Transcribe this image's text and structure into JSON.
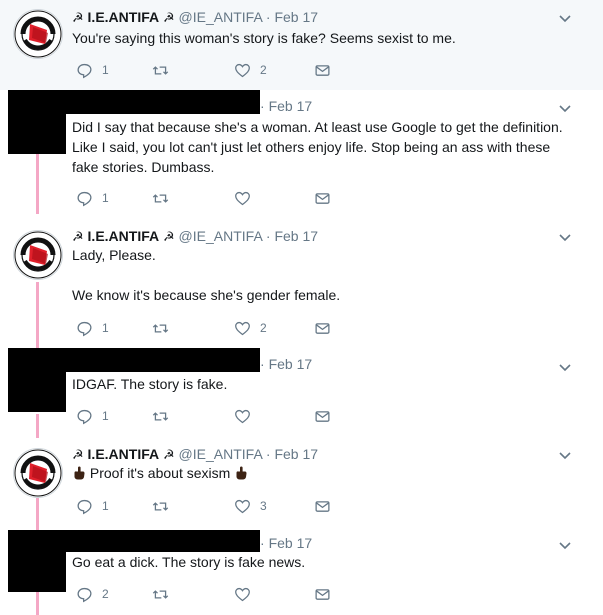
{
  "icons": {
    "reply": "reply-icon",
    "retweet": "retweet-icon",
    "like": "heart-icon",
    "dm": "envelope-icon",
    "more": "chevron-down-icon",
    "emoji": "middle-finger-emoji"
  },
  "colors": {
    "thread_line": "#f4a7c5",
    "muted": "#657786",
    "text": "#14171a",
    "highlight_bg": "#f5f8fa",
    "antifa_red": "#e0202b"
  },
  "avatar_text": "ANTIFASCHISTISCHE AKTION",
  "tweets": [
    {
      "author": "I.E.ANTIFA",
      "handle": "@IE_ANTIFA",
      "sep": "·",
      "date": "Feb 17",
      "lines": [
        "You're saying this woman's story is fake? Seems sexist to me."
      ],
      "replies": "1",
      "retweets": "",
      "likes": "2"
    },
    {
      "author": "",
      "handle": "",
      "sep": "·",
      "date": "Feb 17",
      "lines": [
        "Did I say that because she's a woman. At least use Google to get the definition.",
        "Like I said, you lot can't just let others enjoy life. Stop being an ass with these",
        "fake stories. Dumbass."
      ],
      "replies": "1",
      "retweets": "",
      "likes": ""
    },
    {
      "author": "I.E.ANTIFA",
      "handle": "@IE_ANTIFA",
      "sep": "·",
      "date": "Feb 17",
      "lines": [
        "Lady, Please.",
        "",
        "We know it's because she's gender female."
      ],
      "replies": "1",
      "retweets": "",
      "likes": "2"
    },
    {
      "author": "",
      "handle": "",
      "sep": "·",
      "date": "Feb 17",
      "lines": [
        "IDGAF. The story is fake."
      ],
      "replies": "1",
      "retweets": "",
      "likes": ""
    },
    {
      "author": "I.E.ANTIFA",
      "handle": "@IE_ANTIFA",
      "sep": "·",
      "date": "Feb 17",
      "text_main": "Proof it's about sexism",
      "replies": "1",
      "retweets": "",
      "likes": "3"
    },
    {
      "author": "",
      "handle": "",
      "sep": "·",
      "date": "Feb 17",
      "lines": [
        "Go eat a dick. The story is fake news."
      ],
      "replies": "2",
      "retweets": "",
      "likes": ""
    }
  ]
}
